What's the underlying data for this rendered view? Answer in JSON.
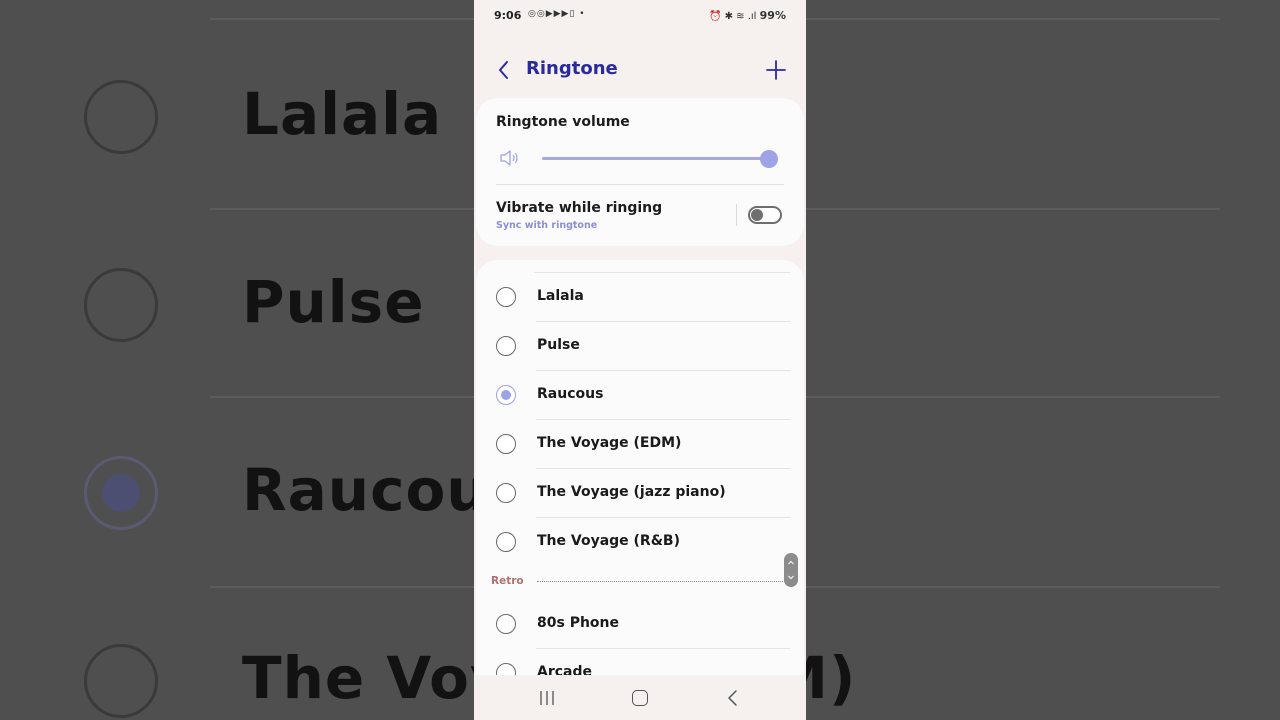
{
  "background": {
    "items": [
      {
        "label": "Lalala",
        "selected": false
      },
      {
        "label": "Pulse",
        "selected": false
      },
      {
        "label": "Raucous",
        "selected": true
      },
      {
        "label": "The Voyage (EDM)",
        "selected": false
      }
    ]
  },
  "status_bar": {
    "time": "9:06",
    "left_icons": "◎◎▶▶▶▯ •",
    "right_icons": "⏰ ✱ ≋ .ıl ",
    "battery": "99%"
  },
  "header": {
    "title": "Ringtone",
    "back_icon": "chevron-left-icon",
    "add_icon": "plus-icon"
  },
  "settings": {
    "volume_label": "Ringtone volume",
    "volume_level": 1.0,
    "vibrate_label": "Vibrate while ringing",
    "vibrate_sub": "Sync with ringtone",
    "vibrate_on": false
  },
  "ringtones": [
    {
      "label": "Lalala",
      "selected": false
    },
    {
      "label": "Pulse",
      "selected": false
    },
    {
      "label": "Raucous",
      "selected": true
    },
    {
      "label": "The Voyage (EDM)",
      "selected": false
    },
    {
      "label": "The Voyage (jazz piano)",
      "selected": false
    },
    {
      "label": "The Voyage (R&B)",
      "selected": false
    }
  ],
  "section": {
    "label": "Retro"
  },
  "retro_ringtones": [
    {
      "label": "80s Phone",
      "selected": false
    },
    {
      "label": "Arcade",
      "selected": false
    }
  ],
  "colors": {
    "accent": "#9ea2e6",
    "title": "#2a2a9e",
    "section_label": "#b07070"
  }
}
